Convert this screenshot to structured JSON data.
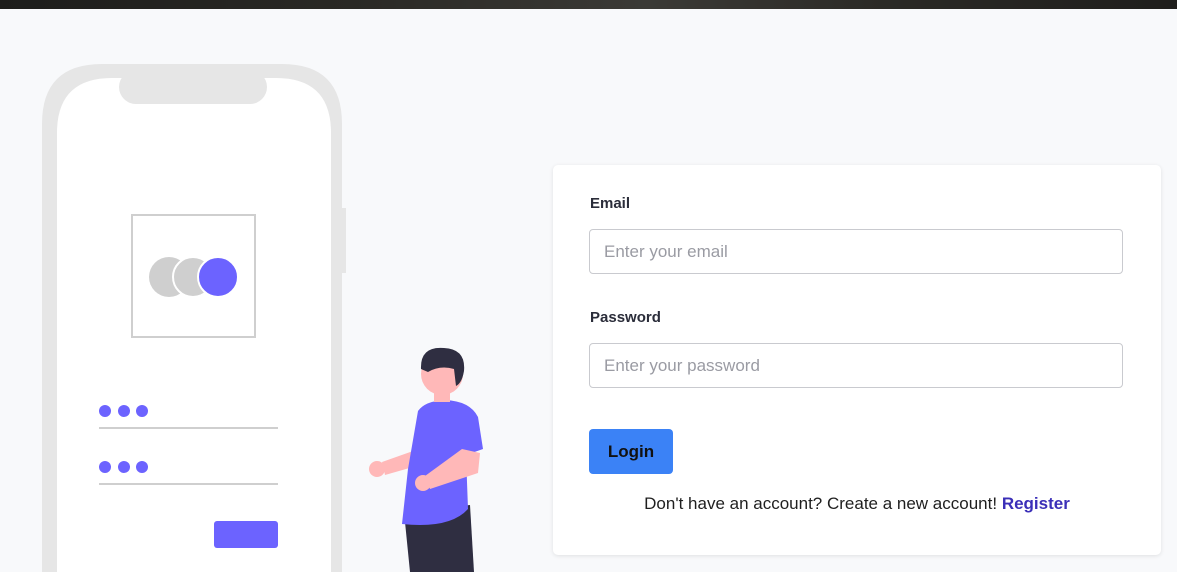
{
  "colors": {
    "accent": "#6c63ff",
    "button": "#3b82f6",
    "link": "#3b2fb8",
    "skin": "#ffb8b8",
    "dark": "#2f2e41"
  },
  "form": {
    "email_label": "Email",
    "email_placeholder": "Enter your email",
    "password_label": "Password",
    "password_placeholder": "Enter your password",
    "login_label": "Login",
    "register_prompt": "Don't have an account? Create a new account!",
    "register_link": "Register"
  },
  "illustration": {
    "icons": [
      "phone-illustration-icon",
      "app-logo-icon",
      "password-dots-icon",
      "person-illustration-icon"
    ]
  }
}
